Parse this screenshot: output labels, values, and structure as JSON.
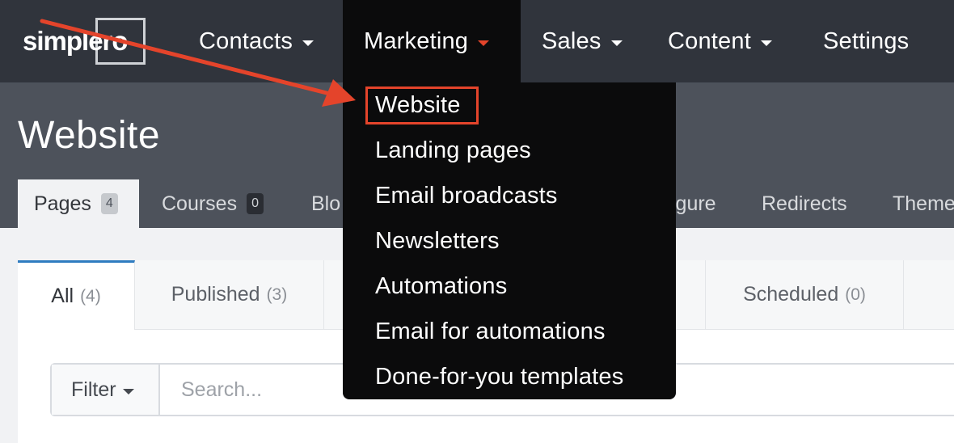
{
  "brand": {
    "logo_text": "simplero"
  },
  "topnav": {
    "items": [
      {
        "label": "Contacts"
      },
      {
        "label": "Marketing"
      },
      {
        "label": "Sales"
      },
      {
        "label": "Content"
      },
      {
        "label": "Settings"
      }
    ]
  },
  "page": {
    "title": "Website"
  },
  "tabs": [
    {
      "label": "Pages",
      "count": "4"
    },
    {
      "label": "Courses",
      "count": "0"
    },
    {
      "label": "Blo"
    },
    {
      "label": "igure"
    },
    {
      "label": "Redirects"
    },
    {
      "label": "Theme"
    }
  ],
  "subtabs": [
    {
      "label": "All",
      "count": "(4)"
    },
    {
      "label": "Published",
      "count": "(3)"
    },
    {
      "label": "Scheduled",
      "count": "(0)"
    }
  ],
  "filter": {
    "label": "Filter",
    "search_placeholder": "Search..."
  },
  "dropdown": {
    "items": [
      {
        "label": "Website"
      },
      {
        "label": "Landing pages"
      },
      {
        "label": "Email broadcasts"
      },
      {
        "label": "Newsletters"
      },
      {
        "label": "Automations"
      },
      {
        "label": "Email for automations"
      },
      {
        "label": "Done-for-you templates"
      }
    ]
  },
  "colors": {
    "accent": "#e4442b",
    "nav_bg": "#30343c",
    "header_bg": "#4d525b",
    "dropdown_bg": "#0b0b0c",
    "active_tab": "#2f7cc0"
  }
}
